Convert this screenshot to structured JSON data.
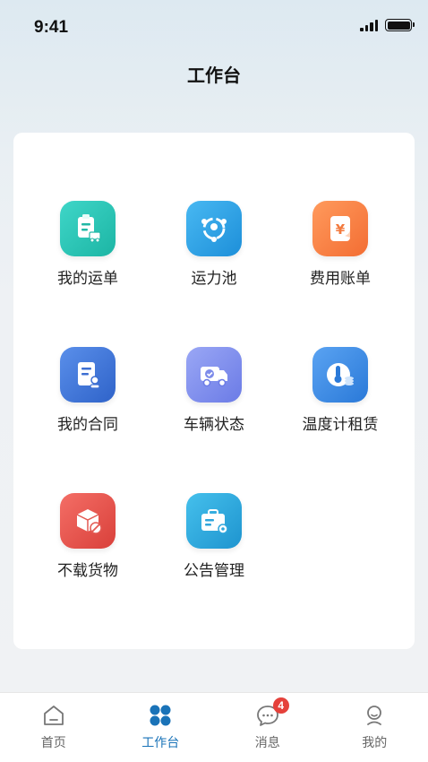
{
  "status_bar": {
    "time": "9:41"
  },
  "header": {
    "title": "工作台"
  },
  "grid": {
    "items": [
      {
        "label": "我的运单",
        "icon": "waybill-truck-icon",
        "color_start": "#3fd6c8",
        "color_end": "#1cb5a4"
      },
      {
        "label": "运力池",
        "icon": "capacity-network-icon",
        "color_start": "#48b8f2",
        "color_end": "#1d8fd9"
      },
      {
        "label": "费用账单",
        "icon": "fee-bill-icon",
        "color_start": "#ff9a5c",
        "color_end": "#f36d33"
      },
      {
        "label": "我的合同",
        "icon": "contract-icon",
        "color_start": "#5a8fea",
        "color_end": "#2f63c9"
      },
      {
        "label": "车辆状态",
        "icon": "vehicle-status-icon",
        "color_start": "#9aa7f5",
        "color_end": "#6b7be6"
      },
      {
        "label": "温度计租赁",
        "icon": "thermometer-rental-icon",
        "color_start": "#5aa3f2",
        "color_end": "#2a79d8"
      },
      {
        "label": "不载货物",
        "icon": "prohibited-cargo-icon",
        "color_start": "#f46e66",
        "color_end": "#d9403a"
      },
      {
        "label": "公告管理",
        "icon": "announcement-icon",
        "color_start": "#45c0ec",
        "color_end": "#1e94cf"
      }
    ]
  },
  "tab_bar": {
    "tabs": [
      {
        "label": "首页",
        "icon": "home-icon"
      },
      {
        "label": "工作台",
        "icon": "workbench-icon",
        "active": true
      },
      {
        "label": "消息",
        "icon": "message-icon",
        "badge": "4"
      },
      {
        "label": "我的",
        "icon": "profile-icon"
      }
    ]
  },
  "colors": {
    "accent": "#1a73b8",
    "badge": "#e5413b",
    "inactive": "#666666"
  }
}
